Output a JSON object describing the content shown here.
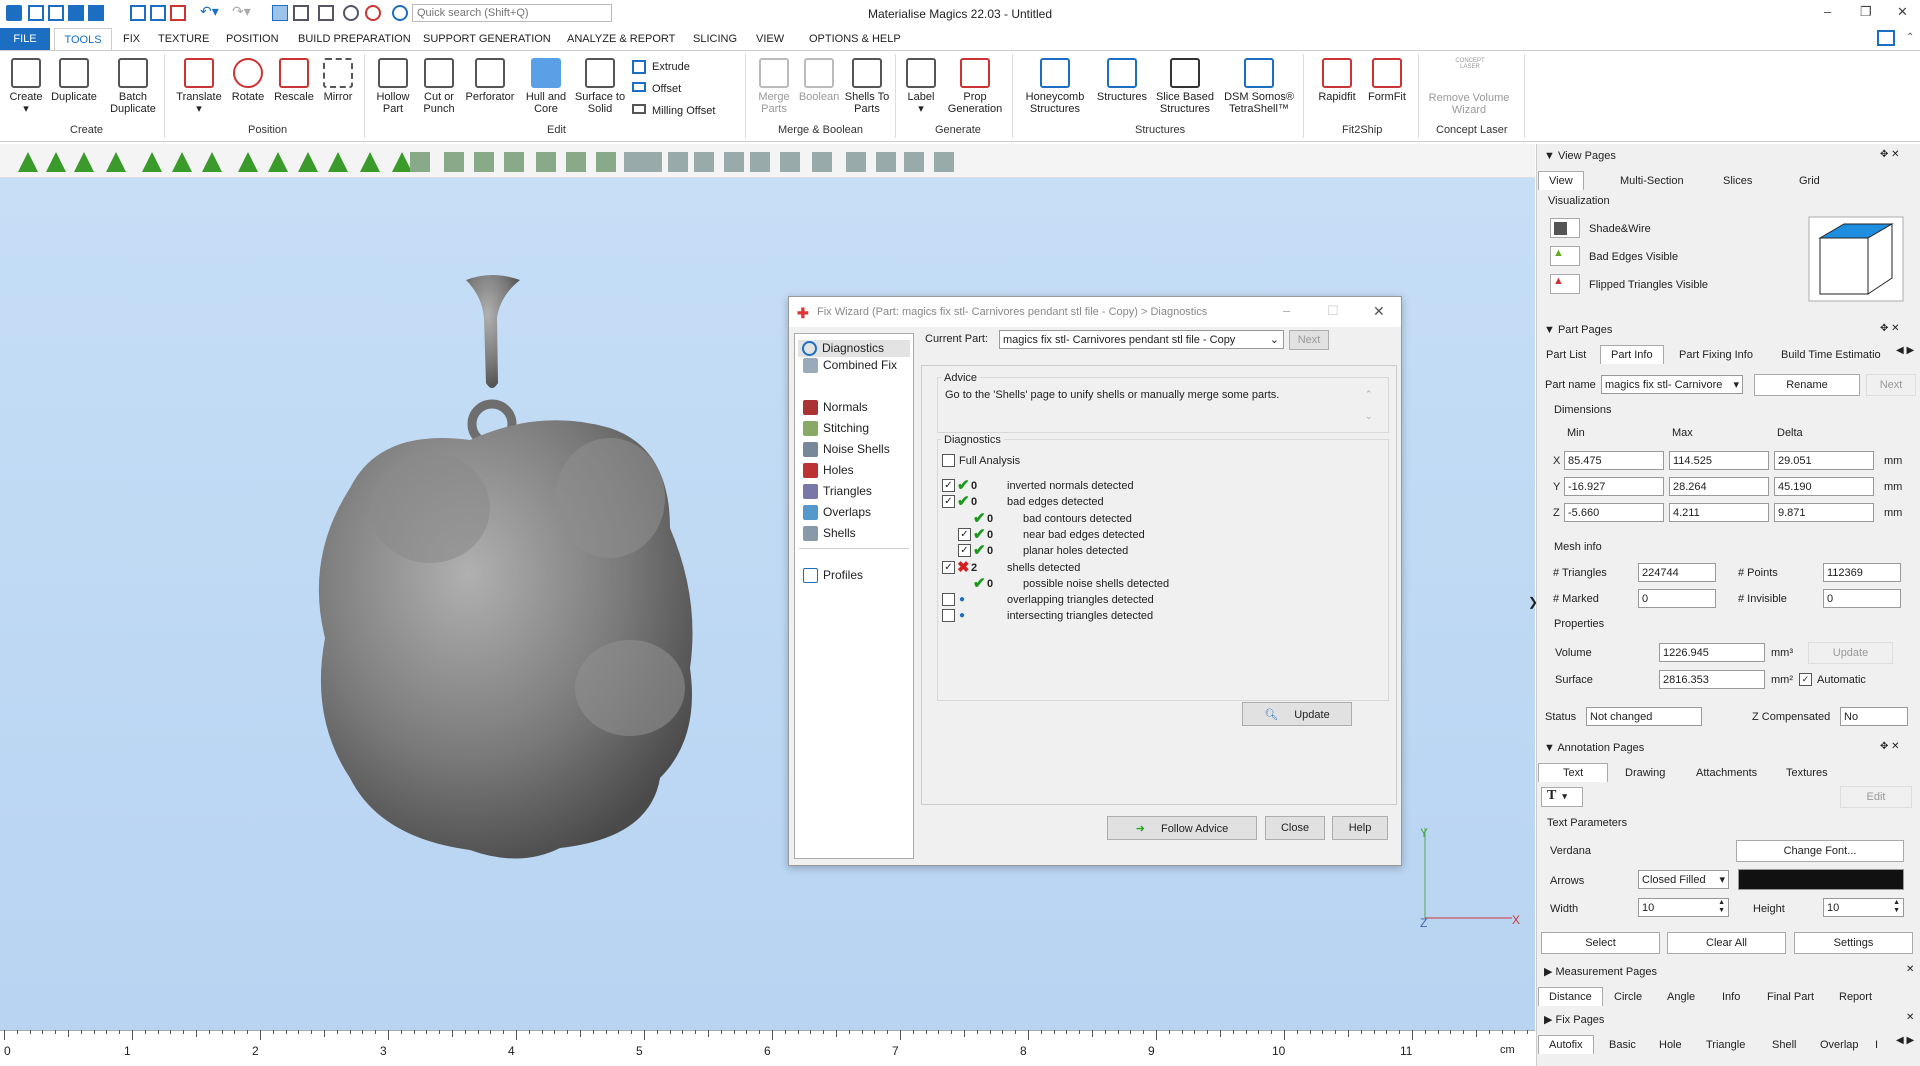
{
  "app": {
    "title": "Materialise Magics 22.03 - Untitled",
    "search_placeholder": "Quick search (Shift+Q)"
  },
  "menu": [
    "FILE",
    "TOOLS",
    "FIX",
    "TEXTURE",
    "POSITION",
    "BUILD PREPARATION",
    "SUPPORT GENERATION",
    "ANALYZE & REPORT",
    "SLICING",
    "VIEW",
    "OPTIONS & HELP"
  ],
  "ribbon": {
    "buttons": [
      "Create",
      "Duplicate",
      "Batch Duplicate",
      "Translate",
      "Rotate",
      "Rescale",
      "Mirror",
      "Hollow Part",
      "Cut or Punch",
      "Perforator",
      "Hull and Core",
      "Surface to Solid",
      "Merge Parts",
      "Boolean",
      "Shells To Parts",
      "Label",
      "Prop Generation",
      "Honeycomb Structures",
      "Structures",
      "Slice Based Structures",
      "DSM Somos® TetraShell™",
      "Rapidfit",
      "FormFit",
      "Remove Volume Wizard"
    ],
    "small": [
      "Extrude",
      "Offset",
      "Milling Offset"
    ],
    "concept": "CONCEPT LASER",
    "groups": [
      "Create",
      "Position",
      "Edit",
      "Merge & Boolean",
      "Generate",
      "Structures",
      "Fit2Ship",
      "Concept Laser"
    ]
  },
  "ruler": [
    "0",
    "1",
    "2",
    "3",
    "4",
    "5",
    "6",
    "7",
    "8",
    "9",
    "10",
    "11"
  ],
  "ruler_unit": "cm",
  "axes": {
    "y": "Y",
    "z": "Z",
    "x": "X"
  },
  "dialog": {
    "title": "Fix Wizard (Part: magics fix stl- Carnivores pendant stl file - Copy) > Diagnostics",
    "nav": [
      "Diagnostics",
      "Combined Fix",
      "Normals",
      "Stitching",
      "Noise Shells",
      "Holes",
      "Triangles",
      "Overlaps",
      "Shells",
      "Profiles"
    ],
    "current_part_label": "Current Part:",
    "current_part": "magics fix stl- Carnivores pendant stl file - Copy",
    "next": "Next",
    "advice_label": "Advice",
    "advice": "Go to the 'Shells' page to unify shells or manually merge some parts.",
    "diag_label": "Diagnostics",
    "full_analysis": "Full Analysis",
    "rows": [
      {
        "count": "0",
        "text": "inverted normals detected"
      },
      {
        "count": "0",
        "text": "bad edges detected"
      },
      {
        "count": "0",
        "text": "bad contours detected"
      },
      {
        "count": "0",
        "text": "near bad edges detected"
      },
      {
        "count": "0",
        "text": "planar holes detected"
      },
      {
        "count": "2",
        "text": "shells detected"
      },
      {
        "count": "0",
        "text": "possible noise shells detected"
      },
      {
        "count": "",
        "text": "overlapping triangles detected"
      },
      {
        "count": "",
        "text": "intersecting triangles detected"
      }
    ],
    "update": "Update",
    "follow": "Follow Advice",
    "close": "Close",
    "help": "Help"
  },
  "panel": {
    "view_pages": "View Pages",
    "view_tabs": [
      "View",
      "Multi-Section",
      "Slices",
      "Grid"
    ],
    "visualization": "Visualization",
    "vis": [
      "Shade&Wire",
      "Bad Edges Visible",
      "Flipped Triangles Visible"
    ],
    "part_pages": "Part Pages",
    "part_tabs": [
      "Part List",
      "Part Info",
      "Part Fixing Info",
      "Build Time Estimatio"
    ],
    "part_name_label": "Part name",
    "part_name": "magics fix stl- Carnivore",
    "rename": "Rename",
    "next": "Next",
    "dimensions": "Dimensions",
    "dim_heads": [
      "Min",
      "Max",
      "Delta"
    ],
    "dims": [
      {
        "a": "X",
        "min": "85.475",
        "max": "114.525",
        "delta": "29.051"
      },
      {
        "a": "Y",
        "min": "-16.927",
        "max": "28.264",
        "delta": "45.190"
      },
      {
        "a": "Z",
        "min": "-5.660",
        "max": "4.211",
        "delta": "9.871"
      }
    ],
    "mm": "mm",
    "mesh_info": "Mesh info",
    "triangles_label": "# Triangles",
    "triangles": "224744",
    "points_label": "# Points",
    "points": "112369",
    "marked_label": "# Marked",
    "marked": "0",
    "invisible_label": "# Invisible",
    "invisible": "0",
    "properties": "Properties",
    "volume_label": "Volume",
    "volume": "1226.945",
    "mm3": "mm³",
    "update": "Update",
    "surface_label": "Surface",
    "surface": "2816.353",
    "mm2": "mm²",
    "automatic": "Automatic",
    "status_label": "Status",
    "status": "Not changed",
    "zcomp_label": "Z Compensated",
    "zcomp": "No",
    "annotation_pages": "Annotation Pages",
    "ann_tabs": [
      "Text",
      "Drawing",
      "Attachments",
      "Textures"
    ],
    "text_tool": "T",
    "edit": "Edit",
    "text_params": "Text Parameters",
    "font": "Verdana",
    "change_font": "Change Font...",
    "arrows_label": "Arrows",
    "arrows": "Closed Filled",
    "width_label": "Width",
    "width": "10",
    "height_label": "Height",
    "height": "10",
    "select": "Select",
    "clear_all": "Clear All",
    "settings": "Settings",
    "measurement_pages": "Measurement Pages",
    "meas_tabs": [
      "Distance",
      "Circle",
      "Angle",
      "Info",
      "Final Part",
      "Report"
    ],
    "fix_pages": "Fix Pages",
    "fix_tabs": [
      "Autofix",
      "Basic",
      "Hole",
      "Triangle",
      "Shell",
      "Overlap",
      "I"
    ]
  }
}
